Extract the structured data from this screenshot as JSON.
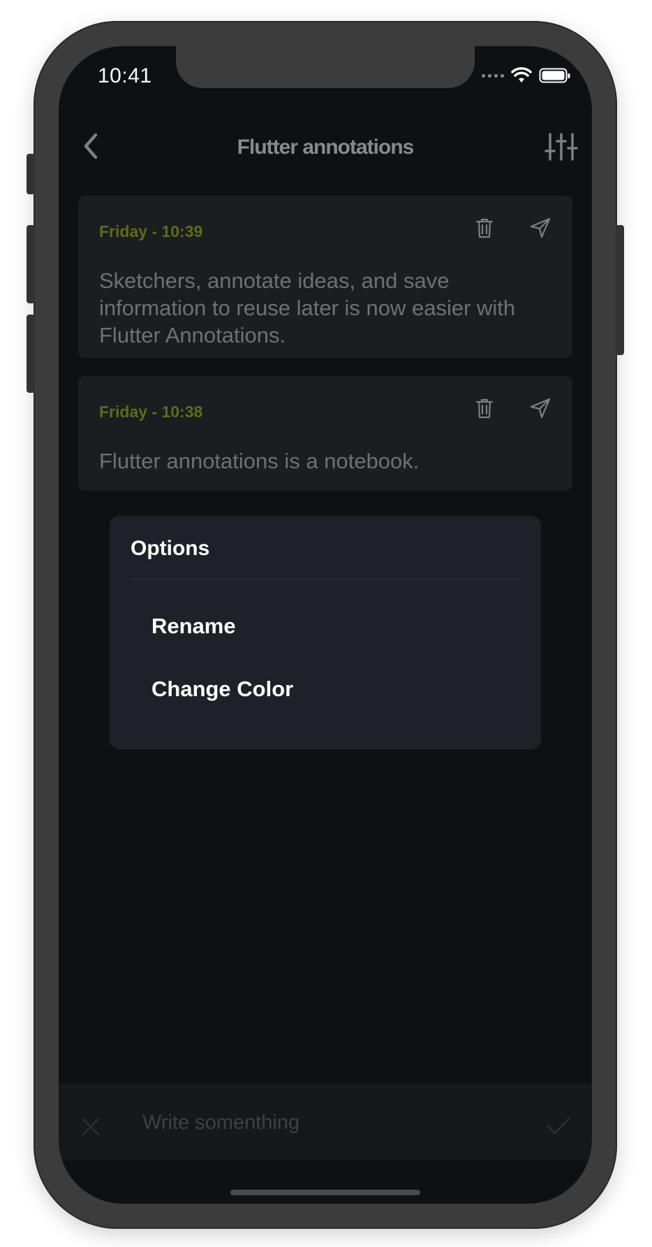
{
  "status_bar": {
    "time": "10:41"
  },
  "nav": {
    "title": "Flutter annotations"
  },
  "notes": [
    {
      "date": "Friday - 10:39",
      "text": "Sketchers, annotate ideas, and save information to reuse later is now easier with Flutter Annotations."
    },
    {
      "date": "Friday - 10:38",
      "text": "Flutter annotations is a notebook."
    }
  ],
  "options_menu": {
    "title": "Options",
    "items": [
      "Rename",
      "Change Color"
    ]
  },
  "composer": {
    "placeholder": "Write somenthing"
  },
  "colors": {
    "background": "#0f1012",
    "card": "#1c1d20",
    "date_accent": "#5f6b1a",
    "menu": "#1f2129",
    "text_muted": "#6f7072"
  },
  "icons": {
    "back": "chevron-left-icon",
    "filter": "sliders-icon",
    "delete": "trash-icon",
    "share": "send-icon",
    "close": "close-icon",
    "confirm": "check-icon"
  }
}
